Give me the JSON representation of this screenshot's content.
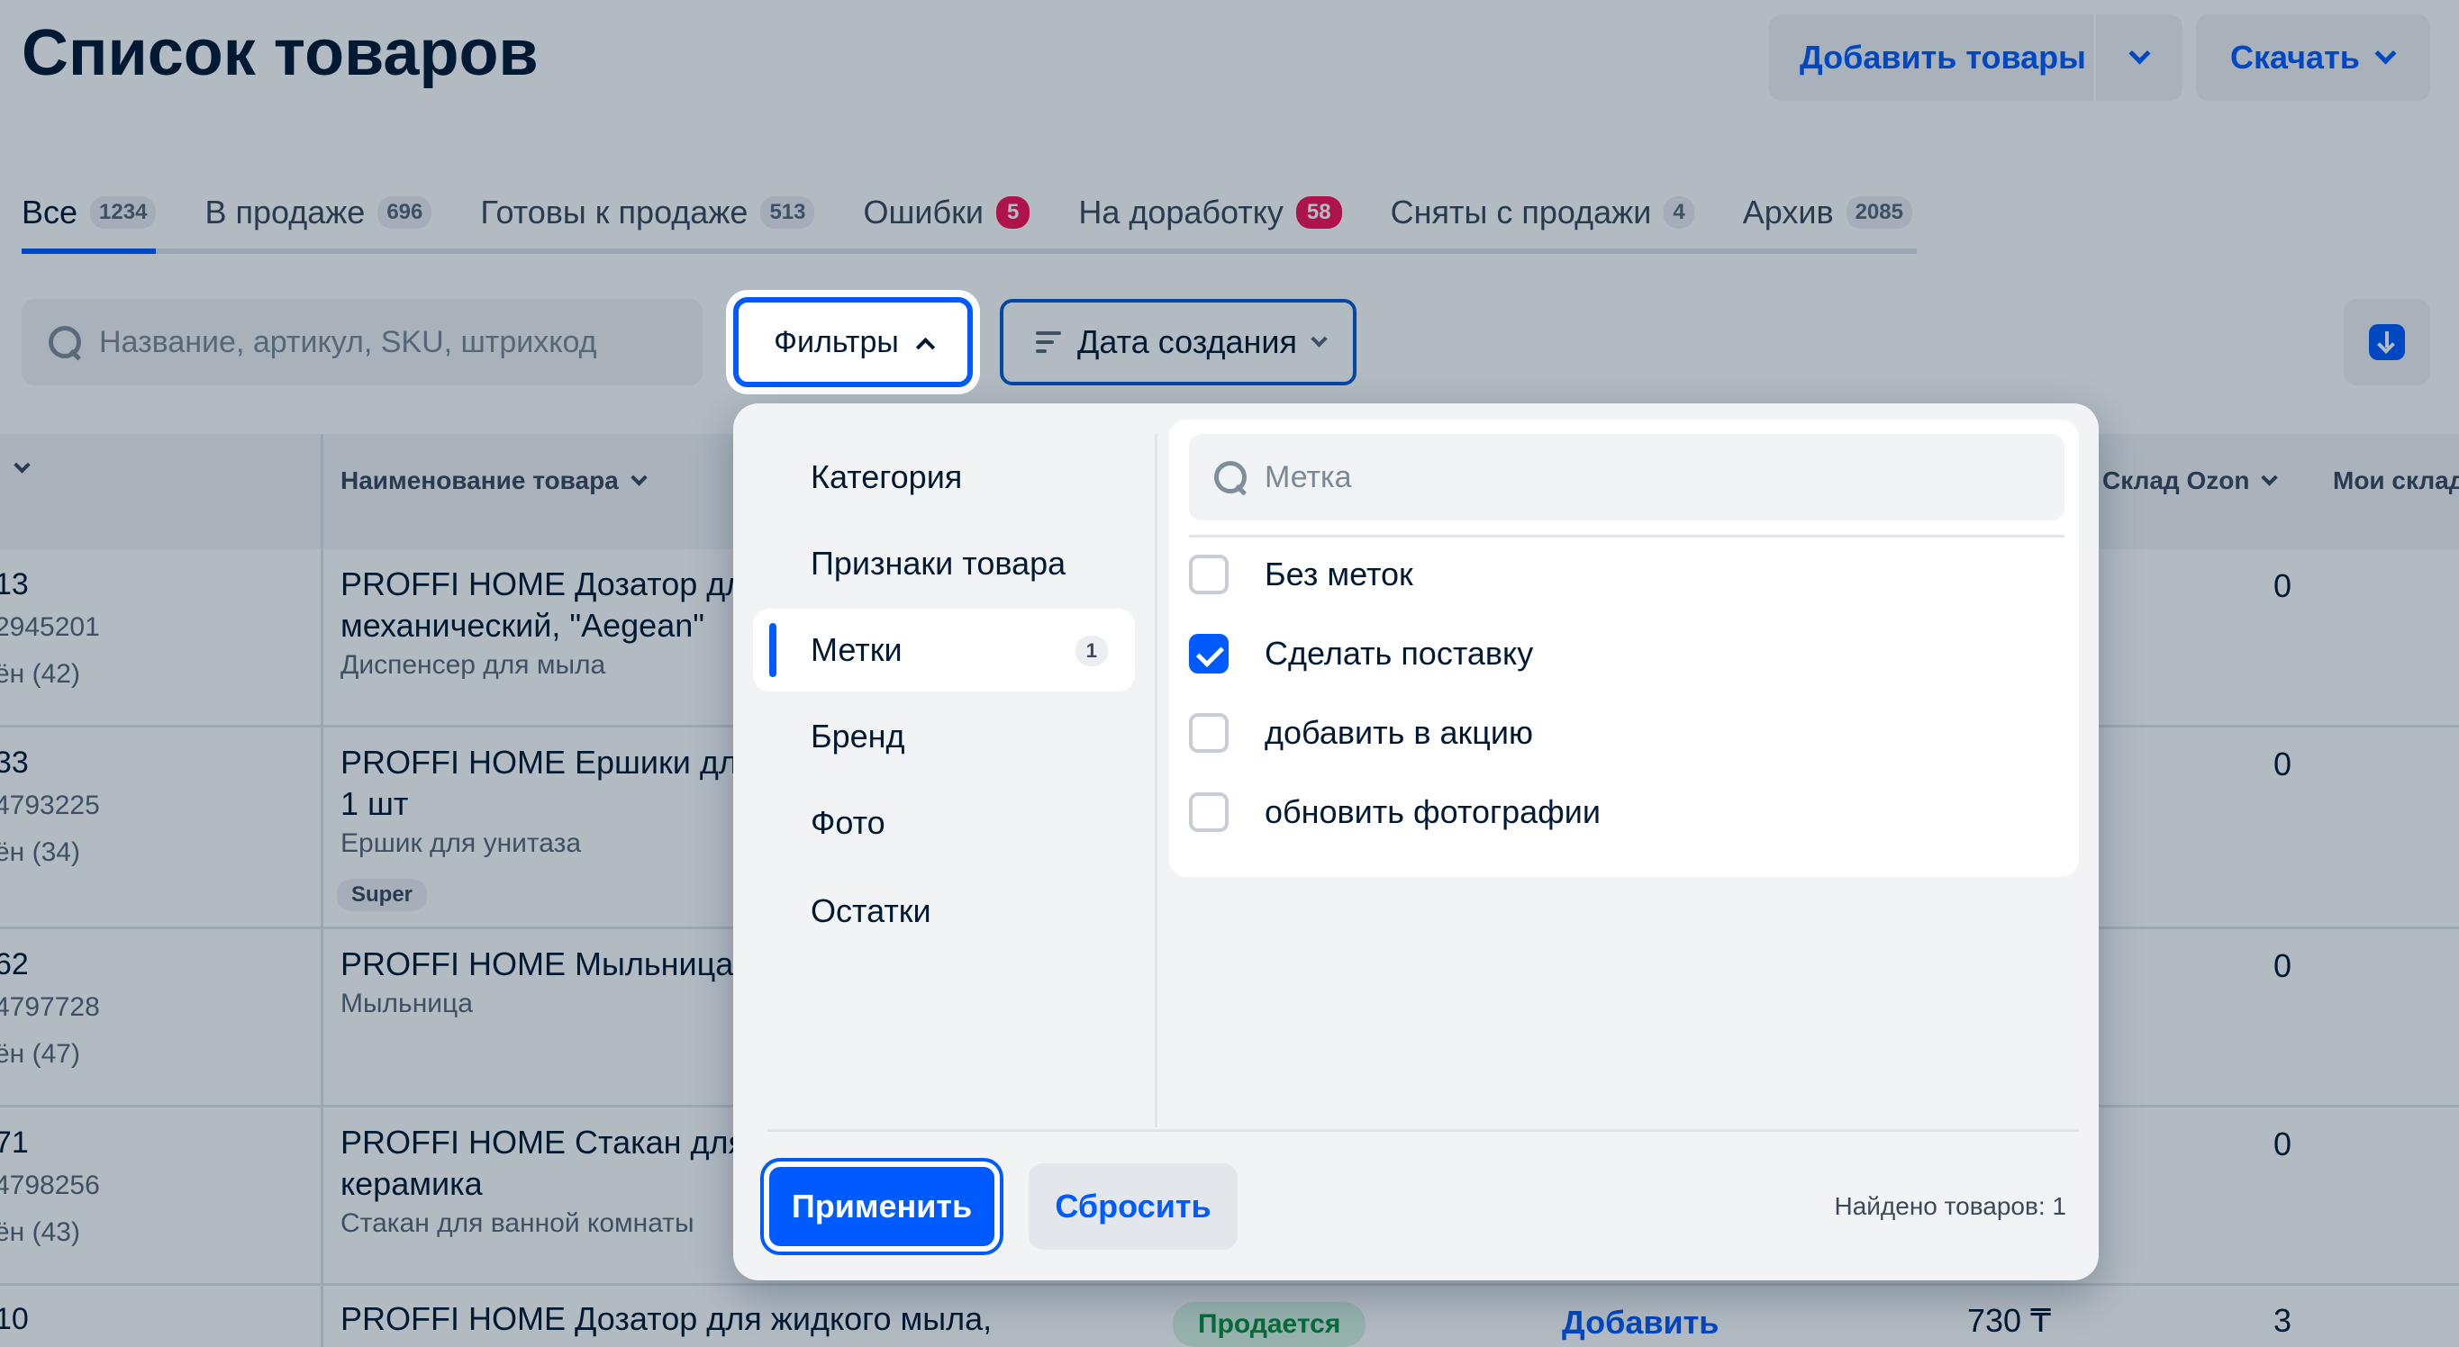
{
  "header": {
    "title": "Список товаров",
    "add_label": "Добавить товары",
    "download_label": "Скачать"
  },
  "tabs": [
    {
      "label": "Все",
      "count": "1234"
    },
    {
      "label": "В продаже",
      "count": "696"
    },
    {
      "label": "Готовы к продаже",
      "count": "513"
    },
    {
      "label": "Ошибки",
      "count": "5"
    },
    {
      "label": "На доработку",
      "count": "58"
    },
    {
      "label": "Сняты с продажи",
      "count": "4"
    },
    {
      "label": "Архив",
      "count": "2085"
    }
  ],
  "toolbar": {
    "search_placeholder": "Название, артикул, SKU, штрихкод",
    "filters_label": "Фильтры",
    "sort_label": "Дата создания"
  },
  "table": {
    "columns": {
      "name": "Наименование товара",
      "ozon_stock": "Склад Ozon",
      "my_stock": "Мои склад"
    },
    "rows": [
      {
        "id": "13",
        "sku": "2945201",
        "meta": "ён (42)",
        "name1": "PROFFI HOME Дозатор для",
        "name2": "механический, \"Aegean\"",
        "type": "Диспенсер для мыла",
        "stock": "0"
      },
      {
        "id": "33",
        "sku": "4793225",
        "meta": "ён (34)",
        "name1": "PROFFI HOME Ершики для у",
        "name2": "1 шт",
        "type": "Ершик для унитаза",
        "badge": "Super",
        "stock": "0"
      },
      {
        "id": "62",
        "sku": "4797728",
        "meta": "ён (47)",
        "name1": "PROFFI HOME Мыльница \"М",
        "type": "Мыльница",
        "stock": "0"
      },
      {
        "id": "71",
        "sku": "4798256",
        "meta": "ён (43)",
        "name1": "PROFFI HOME Стакан для з",
        "name2": "керамика",
        "type": "Стакан для ванной комнаты",
        "stock": "0"
      },
      {
        "id": "10",
        "name1": "PROFFI HOME Дозатор для жидкого мыла,",
        "status": "Продается",
        "add": "Добавить",
        "price": "730 ₸",
        "stock": "3"
      }
    ]
  },
  "filter_panel": {
    "menu": [
      {
        "label": "Категория"
      },
      {
        "label": "Признаки товара"
      },
      {
        "label": "Метки",
        "count": "1"
      },
      {
        "label": "Бренд"
      },
      {
        "label": "Фото"
      },
      {
        "label": "Остатки"
      }
    ],
    "tag_search_placeholder": "Метка",
    "options": [
      {
        "label": "Без меток",
        "checked": false
      },
      {
        "label": "Сделать поставку",
        "checked": true
      },
      {
        "label": "добавить в акцию",
        "checked": false
      },
      {
        "label": "обновить фотографии",
        "checked": false
      }
    ],
    "apply_label": "Применить",
    "reset_label": "Сбросить",
    "found_text": "Найдено товаров:  1"
  },
  "colors": {
    "accent": "#005bff",
    "error_badge": "#f91155",
    "title": "#001a34"
  }
}
